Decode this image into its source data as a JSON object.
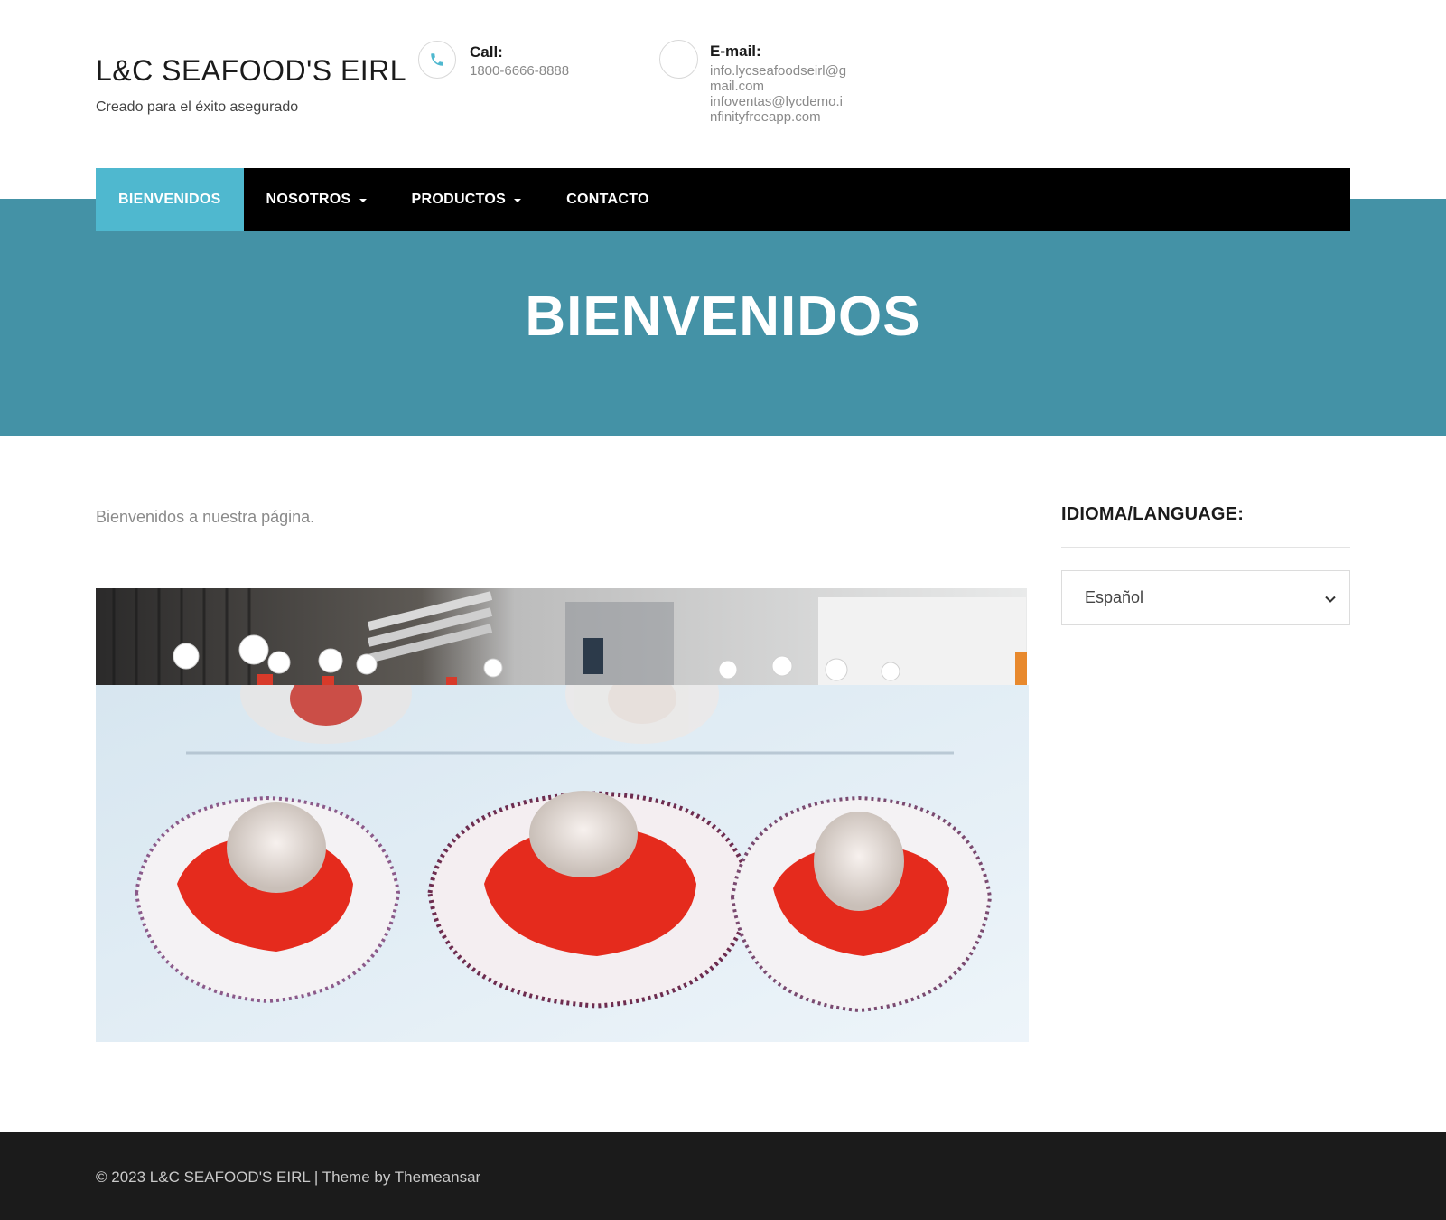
{
  "header": {
    "site_title": "L&C SEAFOOD'S EIRL",
    "tagline": "Creado para el éxito asegurado",
    "call": {
      "label": "Call:",
      "value": "1800-6666-8888",
      "icon": "phone-icon"
    },
    "email": {
      "label": "E-mail:",
      "lines": [
        "info.lycseafoodseirl@g",
        "mail.com",
        "infoventas@lycdemo.i",
        "nfinityfreeapp.com"
      ],
      "icon": "email-icon"
    }
  },
  "nav": {
    "items": [
      {
        "label": "BIENVENIDOS",
        "active": true,
        "dropdown": false
      },
      {
        "label": "NOSOTROS",
        "active": false,
        "dropdown": true
      },
      {
        "label": "PRODUCTOS",
        "active": false,
        "dropdown": true
      },
      {
        "label": "CONTACTO",
        "active": false,
        "dropdown": false
      }
    ]
  },
  "hero": {
    "title": "BIENVENIDOS"
  },
  "main": {
    "intro": "Bienvenidos a nuestra página."
  },
  "sidebar": {
    "title": "IDIOMA/LANGUAGE:",
    "language_selected": "Español"
  },
  "footer": {
    "copyright": "© 2023 L&C SEAFOOD'S EIRL",
    "separator": " | ",
    "theme_text": "Theme by Themeansar"
  },
  "colors": {
    "hero_bg": "#4492a6",
    "nav_active": "#4fb8cf",
    "nav_bg": "#000000",
    "footer_bg": "#1b1b1b",
    "phone_icon": "#4fb8cf"
  }
}
